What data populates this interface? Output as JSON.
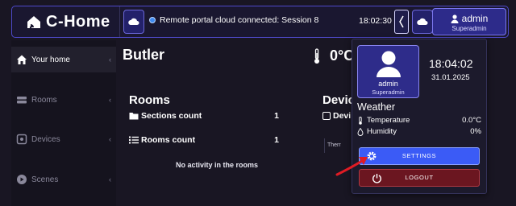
{
  "app": {
    "brand": "C-Home"
  },
  "header": {
    "notice_text": "Remote portal cloud connected: Session 8",
    "time": "18:02:30",
    "user": {
      "name": "admin",
      "role": "Superadmin"
    }
  },
  "sidebar": {
    "items": [
      {
        "label": "Your home",
        "icon": "home-icon",
        "active": true
      },
      {
        "label": "Rooms",
        "icon": "rooms-icon",
        "active": false
      },
      {
        "label": "Devices",
        "icon": "devices-icon",
        "active": false
      },
      {
        "label": "Scenes",
        "icon": "scenes-icon",
        "active": false
      }
    ],
    "chevron": "‹"
  },
  "main": {
    "title": "Butler",
    "temperature_partial": "0°C",
    "rooms_card": {
      "title": "Rooms",
      "stats": [
        {
          "label": "Sections count",
          "value": "1"
        },
        {
          "label": "Rooms count",
          "value": "1"
        }
      ],
      "empty_text": "No activity in the rooms"
    },
    "devices_card": {
      "title": "Devic",
      "subtitle": "Devi",
      "chip": "Therr"
    }
  },
  "user_panel": {
    "name": "admin",
    "role": "Superadmin",
    "time": "18:04:02",
    "date": "31.01.2025",
    "weather": {
      "title": "Weather",
      "temperature_label": "Temperature",
      "temperature_value": "0.0°C",
      "humidity_label": "Humidity",
      "humidity_value": "0%"
    },
    "settings_label": "SETTINGS",
    "logout_label": "LOGOUT"
  },
  "colors": {
    "accent": "#3b5bf6",
    "user_button": "#2d2b8a",
    "logout": "#6b1620",
    "annotation_arrow": "#e01b24"
  }
}
